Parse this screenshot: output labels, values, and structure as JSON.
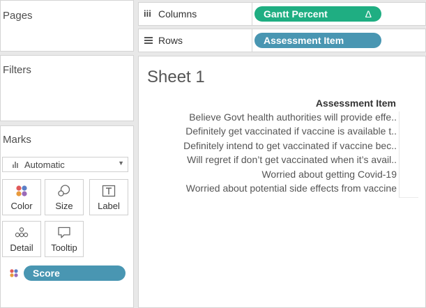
{
  "side": {
    "pages_title": "Pages",
    "filters_title": "Filters",
    "marks_title": "Marks",
    "mark_type": "Automatic",
    "mark_buttons": [
      {
        "label": "Color",
        "icon": "color-dots-icon"
      },
      {
        "label": "Size",
        "icon": "size-shapes-icon"
      },
      {
        "label": "Label",
        "icon": "label-t-icon"
      },
      {
        "label": "Detail",
        "icon": "detail-dots-icon"
      },
      {
        "label": "Tooltip",
        "icon": "tooltip-bubble-icon"
      }
    ],
    "color_field": "Score"
  },
  "shelves": {
    "columns_label": "Columns",
    "columns_field": "Gantt Percent",
    "columns_field_marker": "Δ",
    "rows_label": "Rows",
    "rows_field": "Assessment Item"
  },
  "sheet": {
    "title": "Sheet 1",
    "column_header": "Assessment Item",
    "items": [
      "Believe Govt health authorities will provide effe..",
      "Definitely get vaccinated if vaccine is available t..",
      "Definitely intend to get vaccinated if vaccine bec..",
      "Will regret if don’t get vaccinated when it’s avail..",
      "Worried about getting Covid-19",
      "Worried about potential side effects from vaccine"
    ]
  },
  "colors": {
    "dimension_pill": "#4996b2",
    "measure_pill": "#1fae82",
    "color_dot_red": "#e05a5a",
    "color_dot_blue": "#5b7fc7",
    "color_dot_orange": "#e89a3c",
    "color_dot_purple": "#9a6ab8"
  }
}
